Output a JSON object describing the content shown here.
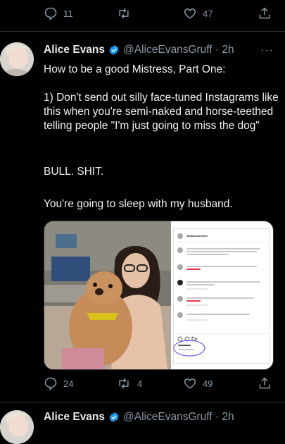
{
  "top_actions": {
    "reply_count": "11",
    "retweet_count": "",
    "like_count": "47"
  },
  "tweet": {
    "name": "Alice Evans",
    "handle": "@AliceEvansGruff · 2h",
    "more_label": "···",
    "text_line1": "How to be a good Mistress, Part One:",
    "text_para2": "1) Don't send out silly face-tuned Instagrams like this when you're semi-naked and horse-teethed telling people \"I'm just going to miss the dog\"",
    "text_para3": "BULL. SHIT.",
    "text_para4": "You're going to sleep with my husband.",
    "reply_count": "24",
    "retweet_count": "4",
    "like_count": "49"
  },
  "next_tweet": {
    "name": "Alice Evans",
    "handle": "@AliceEvansGruff · 2h"
  },
  "embedded_instagram": {
    "username": "iamblancaseuface"
  },
  "colors": {
    "background": "#000000",
    "text": "#e7e9ea",
    "secondary": "#8b98a5",
    "verified": "#1d9bf0"
  }
}
